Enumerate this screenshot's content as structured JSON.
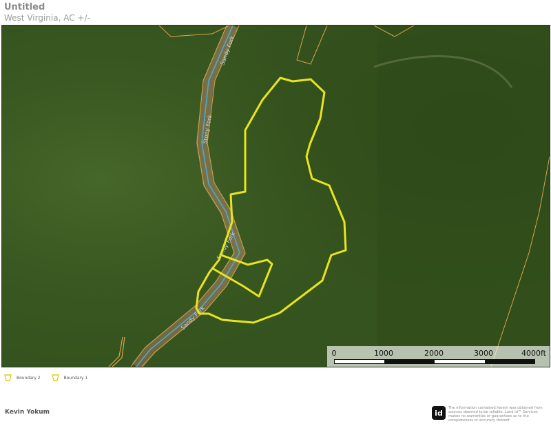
{
  "header": {
    "title": "Untitled",
    "subtitle": "West Virginia,  AC +/-"
  },
  "map": {
    "imagery": "satellite",
    "boundary_color": "#e9e51c",
    "parcel_line_color": "#d9a54a",
    "water_line_color": "#5ba3c9",
    "labels": {
      "stream_1": "Sandy Fork",
      "stream_2": "Stony Fork",
      "stream_3": "Sandy Fork",
      "stream_4": "Sandy Fork"
    },
    "scalebar": {
      "labels": [
        "0",
        "1000",
        "2000",
        "3000",
        "4000ft"
      ]
    }
  },
  "legend": {
    "items": [
      {
        "label": "Boundary 2",
        "icon": "boundary-icon"
      },
      {
        "label": "Boundary 1",
        "icon": "boundary-icon"
      }
    ]
  },
  "footer": {
    "author": "Kevin Yokum",
    "logo_text": "id",
    "disclaimer": "The information contained herein was obtained from sources deemed to be reliable. Land id™ Services makes no warranties or guarantees as to the completeness or accuracy thereof."
  }
}
